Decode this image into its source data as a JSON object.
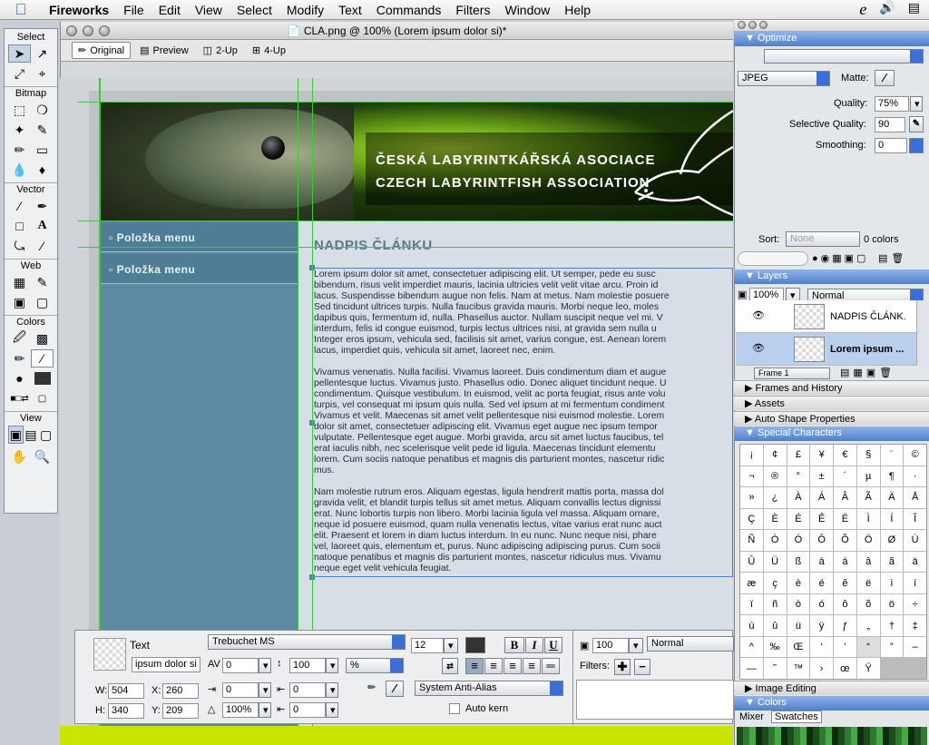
{
  "menubar": {
    "apple": "",
    "app": "Fireworks",
    "items": [
      "File",
      "Edit",
      "View",
      "Select",
      "Modify",
      "Text",
      "Commands",
      "Filters",
      "Window",
      "Help"
    ]
  },
  "tools": {
    "sections": [
      "Select",
      "Bitmap",
      "Vector",
      "Web",
      "Colors",
      "View"
    ]
  },
  "document": {
    "title": "CLA.png @ 100% (Lorem ipsum dolor si)*",
    "tabs": [
      "Original",
      "Preview",
      "2-Up",
      "4-Up"
    ]
  },
  "banner": {
    "line1": "ČESKÁ LABYRINTKÁŘSKÁ ASOCIACE",
    "line2": "CZECH LABYRINTFISH ASSOCIATION"
  },
  "sidebar": {
    "items": [
      "Položka menu",
      "Položka menu"
    ]
  },
  "article": {
    "title": "NADPIS ČLÁNKU",
    "p1": [
      "Lorem ipsum dolor sit amet, consectetuer adipiscing elit. Ut semper, pede eu susc",
      "bibendum, risus velit imperdiet mauris, lacinia ultricies velit velit vitae arcu. Proin id",
      "lacus. Suspendisse bibendum augue non felis. Nam at metus. Nam molestie posuere",
      "Sed tincidunt ultrices turpis. Nulla faucibus gravida mauris. Morbi neque leo, moles",
      "dapibus quis, fermentum id, nulla. Phasellus auctor. Nullam suscipit neque vel mi. V",
      "interdum, felis id congue euismod, turpis lectus ultrices nisi, at gravida sem nulla u",
      "Integer eros ipsum, vehicula sed, facilisis sit amet, varius congue, est. Aenean lorem",
      "lacus, imperdiet quis, vehicula sit amet, laoreet nec, enim."
    ],
    "p2": [
      "Vivamus venenatis. Nulla facilisi. Vivamus laoreet. Duis condimentum diam et augue",
      "pellentesque luctus. Vivamus justo. Phasellus odio. Donec aliquet tincidunt neque. U",
      "condimentum. Quisque vestibulum. In euismod, velit ac porta feugiat, risus ante volu",
      "turpis, vel consequat mi ipsum quis nulla. Sed vel ipsum at mi fermentum condiment",
      "Vivamus et velit. Maecenas sit amet velit pellentesque nisi euismod molestie. Lorem",
      "dolor sit amet, consectetuer adipiscing elit. Vivamus eget augue nec ipsum tempor",
      "vulputate. Pellentesque eget augue. Morbi gravida, arcu sit amet luctus faucibus, tel",
      "erat iaculis nibh, nec scelerisque velit pede id ligula. Maecenas tincidunt elementu",
      "lorem. Cum sociis natoque penatibus et magnis dis parturient montes, nascetur ridic",
      "mus."
    ],
    "p3": [
      "Nam molestie rutrum eros. Aliquam egestas, ligula hendrerit mattis porta, massa dol",
      "gravida velit, et blandit turpis tellus sit amet metus. Aliquam convallis lectus dignissi",
      "erat. Nunc lobortis turpis non libero. Morbi lacinia ligula vel massa. Aliquam ornare,",
      "neque id posuere euismod, quam nulla venenatis lectus, vitae varius erat nunc auct",
      "elit. Praesent et lorem in diam luctus interdum. In eu nunc. Nunc neque nisi, phare",
      "vel, laoreet quis, elementum et, purus. Nunc adipiscing adipiscing purus. Cum socii",
      "natoque penatibus et magnis dis parturient montes, nascetur ridiculus mus. Vivamu",
      "neque eget velit vehicula feugiat."
    ]
  },
  "properties": {
    "type_label": "Text",
    "name": "ipsum dolor si",
    "font": "Trebuchet MS",
    "size": "12",
    "kerning": "0",
    "leading": "100",
    "leading_unit": "%",
    "indent": "0",
    "space_before": "0",
    "space_after": "0",
    "w": "504",
    "h": "340",
    "x": "260",
    "y": "209",
    "scale": "100%",
    "bold": "B",
    "italic": "I",
    "underline": "U",
    "antialias": "System Anti-Alias",
    "autokern": "Auto kern",
    "opacity": "100",
    "blend": "Normal",
    "filters_label": "Filters:",
    "labels": {
      "w": "W:",
      "h": "H:",
      "x": "X:",
      "y": "Y:"
    }
  },
  "optimize": {
    "title": "Optimize",
    "format": "JPEG",
    "matte_label": "Matte:",
    "quality_label": "Quality:",
    "quality": "75%",
    "selq_label": "Selective Quality:",
    "selq": "90",
    "smooth_label": "Smoothing:",
    "smooth": "0",
    "sort_label": "Sort:",
    "sort": "None",
    "colors_count": "0 colors"
  },
  "layers": {
    "title": "Layers",
    "opacity": "100%",
    "blend": "Normal",
    "rows": [
      "NADPIS ČLÁNK.",
      "Lorem ipsum ..."
    ],
    "frame": "Frame 1"
  },
  "collapsed_panels": [
    "Frames and History",
    "Assets",
    "Auto Shape Properties"
  ],
  "special": {
    "title": "Special Characters",
    "chars": [
      "¡",
      "¢",
      "£",
      "¥",
      "€",
      "§",
      "¨",
      "©",
      "¬",
      "®",
      "°",
      "±",
      "´",
      "µ",
      "¶",
      "·",
      "»",
      "¿",
      "À",
      "Á",
      "Â",
      "Ã",
      "Ä",
      "Å",
      "Ç",
      "È",
      "É",
      "Ê",
      "Ë",
      "Ì",
      "Í",
      "Î",
      "Ñ",
      "Ò",
      "Ó",
      "Ô",
      "Õ",
      "Ö",
      "Ø",
      "Ù",
      "Û",
      "Ü",
      "ß",
      "à",
      "á",
      "â",
      "ã",
      "ä",
      "æ",
      "ç",
      "è",
      "é",
      "ê",
      "ë",
      "ì",
      "í",
      "ï",
      "ñ",
      "ò",
      "ó",
      "ô",
      "õ",
      "ö",
      "÷",
      "ú",
      "û",
      "ü",
      "ÿ",
      "ƒ",
      "„",
      "†",
      "‡",
      "^",
      "‰",
      "Œ",
      "‘",
      "’",
      "“",
      "”",
      "–",
      "—",
      "˜",
      "™",
      "›",
      "œ",
      "Ÿ"
    ]
  },
  "image_editing": "Image Editing",
  "colors": {
    "title": "Colors",
    "tabs": [
      "Mixer",
      "Swatches"
    ]
  }
}
